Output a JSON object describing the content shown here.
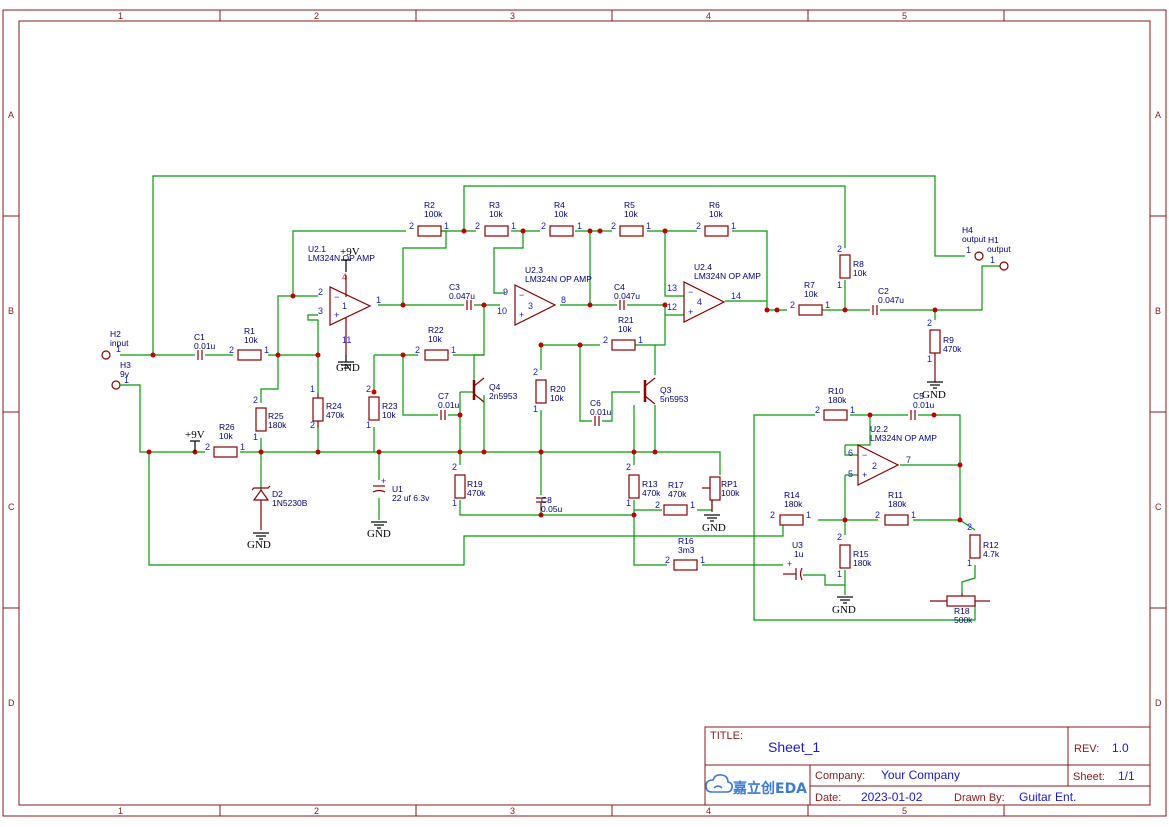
{
  "border": {
    "columns": [
      "1",
      "2",
      "3",
      "4",
      "5"
    ],
    "rows": [
      "A",
      "B",
      "C",
      "D"
    ]
  },
  "title_block": {
    "title_key": "TITLE:",
    "title": "Sheet_1",
    "rev_key": "REV:",
    "rev": "1.0",
    "company_key": "Company:",
    "company": "Your Company",
    "sheet_key": "Sheet:",
    "sheet": "1/1",
    "date_key": "Date:",
    "date": "2023-01-02",
    "drawn_key": "Drawn By:",
    "drawn_by": "Guitar Ent.",
    "logo_text": "嘉立创EDA"
  },
  "components": {
    "R1": {
      "ref": "R1",
      "value": "10k"
    },
    "R2": {
      "ref": "R2",
      "value": "100k"
    },
    "R3": {
      "ref": "R3",
      "value": "10k"
    },
    "R4": {
      "ref": "R4",
      "value": "10k"
    },
    "R5": {
      "ref": "R5",
      "value": "10k"
    },
    "R6": {
      "ref": "R6",
      "value": "10k"
    },
    "R7": {
      "ref": "R7",
      "value": "10k"
    },
    "R8": {
      "ref": "R8",
      "value": "10k"
    },
    "R9": {
      "ref": "R9",
      "value": "470k"
    },
    "R10": {
      "ref": "R10",
      "value": "180k"
    },
    "R11": {
      "ref": "R11",
      "value": "180k"
    },
    "R12": {
      "ref": "R12",
      "value": "4.7k"
    },
    "R13": {
      "ref": "R13",
      "value": "470k"
    },
    "R14": {
      "ref": "R14",
      "value": "180k"
    },
    "R15": {
      "ref": "R15",
      "value": "180k"
    },
    "R16": {
      "ref": "R16",
      "value": "3m3"
    },
    "R17": {
      "ref": "R17",
      "value": "470k"
    },
    "R18": {
      "ref": "R18",
      "value": "500k"
    },
    "R19": {
      "ref": "R19",
      "value": "470k"
    },
    "R20": {
      "ref": "R20",
      "value": "10k"
    },
    "R21": {
      "ref": "R21",
      "value": "10k"
    },
    "R22": {
      "ref": "R22",
      "value": "10k"
    },
    "R23": {
      "ref": "R23",
      "value": "10k"
    },
    "R24": {
      "ref": "R24",
      "value": "470k"
    },
    "R25": {
      "ref": "R25",
      "value": "180k"
    },
    "R26": {
      "ref": "R26",
      "value": "10k"
    },
    "RP1": {
      "ref": "RP1",
      "value": "100k"
    },
    "C1": {
      "ref": "C1",
      "value": "0.01u"
    },
    "C2": {
      "ref": "C2",
      "value": "0.047u"
    },
    "C3": {
      "ref": "C3",
      "value": "0.047u"
    },
    "C4": {
      "ref": "C4",
      "value": "0.047u"
    },
    "C5": {
      "ref": "C5",
      "value": "0.01u"
    },
    "C6": {
      "ref": "C6",
      "value": "0.01u"
    },
    "C7": {
      "ref": "C7",
      "value": "0.01u"
    },
    "C8": {
      "ref": "C8",
      "value": "0.05u"
    },
    "U1": {
      "ref": "U1",
      "value": "22 uf 6.3v"
    },
    "U3": {
      "ref": "U3",
      "value": "1u"
    },
    "Q3": {
      "ref": "Q3",
      "value": "5n5953"
    },
    "Q4": {
      "ref": "Q4",
      "value": "2n5953"
    },
    "D2": {
      "ref": "D2",
      "value": "1N5230B"
    },
    "U21": {
      "ref": "U2.1",
      "value": "LM324N OP AMP"
    },
    "U22": {
      "ref": "U2.2",
      "value": "LM324N OP AMP"
    },
    "U23": {
      "ref": "U2.3",
      "value": "LM324N OP AMP"
    },
    "U24": {
      "ref": "U2.4",
      "value": "LM324N OP AMP"
    },
    "H1": {
      "ref": "H1",
      "value": "output"
    },
    "H2": {
      "ref": "H2",
      "value": "input"
    },
    "H3": {
      "ref": "H3",
      "value": "9v"
    },
    "H4": {
      "ref": "H4",
      "value": "output"
    }
  },
  "power": {
    "vcc": "+9V",
    "gnd": "GND"
  },
  "opamp_pins": {
    "u21": {
      "n": "1",
      "inv": "2",
      "ninv": "3",
      "out": "1",
      "vcc": "4",
      "vee": "11"
    },
    "u23": {
      "n": "3",
      "inv": "9",
      "ninv": "10",
      "out": "8"
    },
    "u24": {
      "n": "4",
      "inv": "13",
      "ninv": "12",
      "out": "14"
    },
    "u22": {
      "n": "2",
      "inv": "6",
      "ninv": "5",
      "out": "7"
    }
  },
  "pin_numbers": {
    "one": "1",
    "two": "2"
  }
}
